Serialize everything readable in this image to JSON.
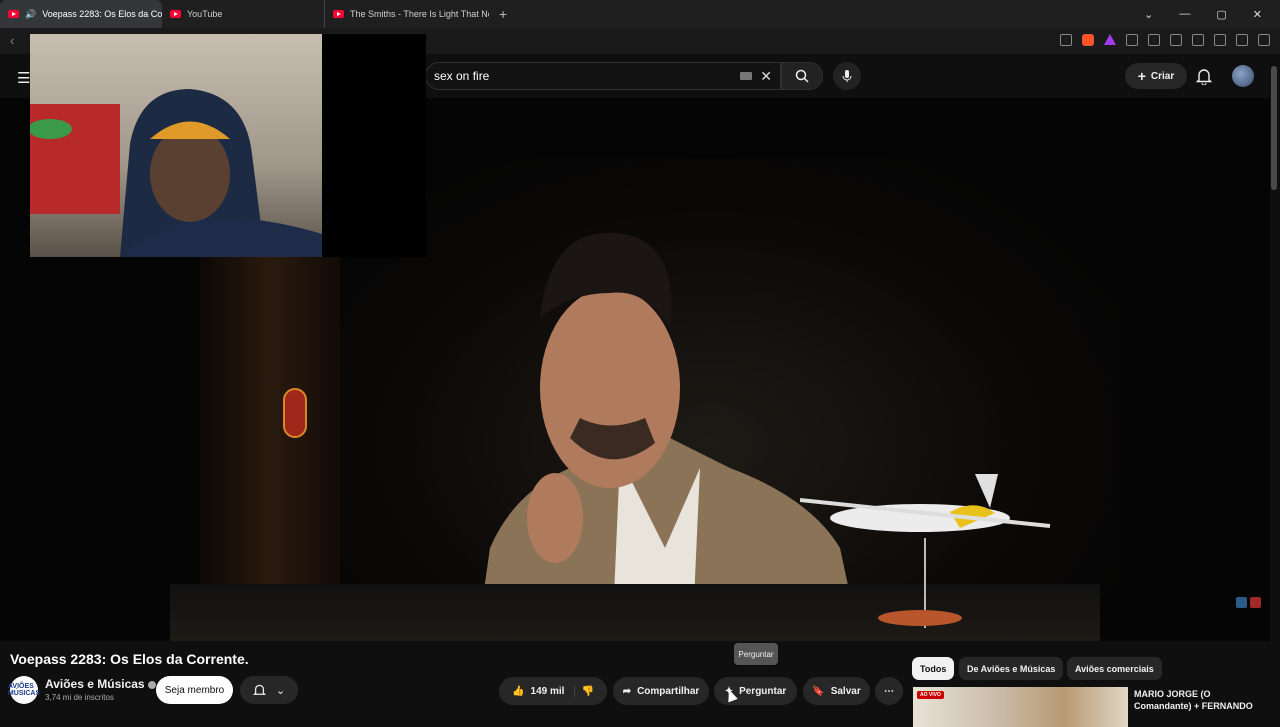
{
  "browser": {
    "tabs": [
      {
        "label": "Voepass 2283: Os Elos da Co"
      },
      {
        "label": "YouTube"
      },
      {
        "label": "The Smiths - There Is Light That Nev"
      }
    ],
    "new_tab": "+",
    "window_controls": {
      "chevron": "⌄",
      "min": "—",
      "max": "▢",
      "close": "✕"
    }
  },
  "header": {
    "search_query": "sex on fire",
    "create_label": "Criar"
  },
  "video": {
    "title": "Voepass 2283: Os Elos da Corrente."
  },
  "channel": {
    "avatar_text": "AVIÕES MÚSICAS",
    "name": "Aviões e Músicas",
    "subscribers": "3,74 mi de inscritos",
    "member_label": "Seja membro"
  },
  "actions": {
    "likes": "149 mil",
    "share": "Compartilhar",
    "ask": "Perguntar",
    "save": "Salvar",
    "more": "⋯",
    "tooltip": "Perguntar"
  },
  "related": {
    "chips": [
      "Todos",
      "De Aviões e Músicas",
      "Aviões comerciais"
    ],
    "live_badge": "AO VIVO",
    "first_title": "MARIO JORGE (O Comandante) + FERNANDO"
  },
  "colors": {
    "accent": "#ff0033",
    "brave": "#fb542b",
    "live": "#cc0000"
  }
}
